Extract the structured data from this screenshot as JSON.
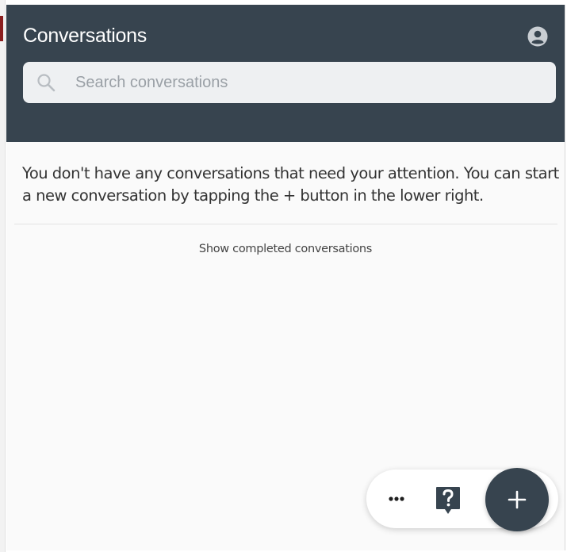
{
  "header": {
    "title": "Conversations",
    "background_color": "#37444f",
    "account_icon": "user-circle-icon"
  },
  "search": {
    "placeholder": "Search conversations",
    "value": "",
    "icon": "search-icon"
  },
  "main": {
    "empty_message": "You don't have any conversations that need your attention. You can start a new conversation by tapping the + button in the lower right.",
    "show_completed_label": "Show completed conversations"
  },
  "actions": {
    "more_icon": "more-horizontal-icon",
    "help_icon": "help-question-icon",
    "new_icon": "plus-icon",
    "fab_color": "#37444f"
  }
}
